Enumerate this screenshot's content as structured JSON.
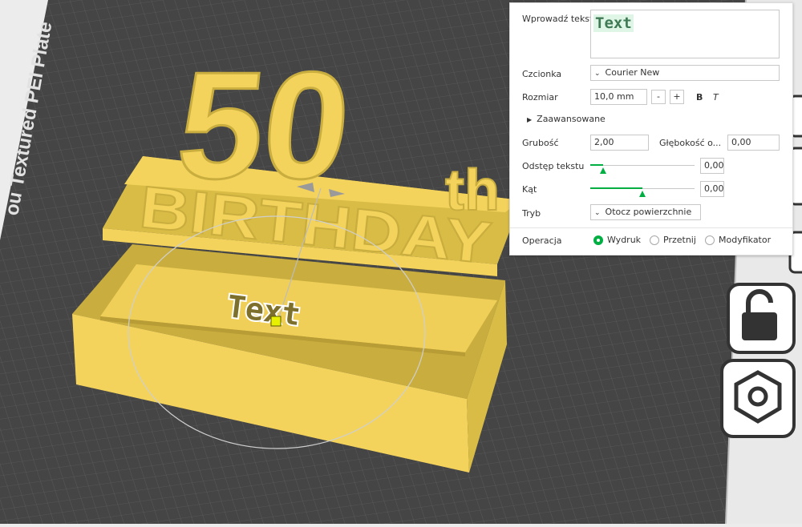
{
  "scene": {
    "plate_label": "ou Textured PEI Plate",
    "model_title_number": "50",
    "model_title_suffix": "th",
    "model_subtitle": "BIRTHDAY",
    "embossed_text": "Text"
  },
  "panel": {
    "text_input_label": "Wprowadź tekst",
    "text_input_value": "Text",
    "font_label": "Czcionka",
    "font_value": "Courier New",
    "size_label": "Rozmiar",
    "size_value": "10,0 mm",
    "size_decrease": "-",
    "size_increase": "+",
    "bold_label": "B",
    "italic_label": "T",
    "advanced_label": "Zaawansowane",
    "thickness_label": "Grubość",
    "thickness_value": "2,00",
    "depth_label": "Głębokość o...",
    "depth_value": "0,00",
    "spacing_label": "Odstęp tekstu",
    "spacing_value": "0,00",
    "spacing_level": 0.12,
    "angle_label": "Kąt",
    "angle_value": "0,00",
    "angle_level": 0.5,
    "mode_label": "Tryb",
    "mode_value": "Otocz powierzchnie",
    "operation_label": "Operacja",
    "operations": [
      {
        "label": "Wydruk",
        "selected": true
      },
      {
        "label": "Przetnij",
        "selected": false
      },
      {
        "label": "Modyfikator",
        "selected": false
      }
    ]
  },
  "colors": {
    "accent": "#00ae42",
    "model": "#f3d35c",
    "plate": "#4a4a4a",
    "panel_bg": "#ffffff"
  },
  "icons": [
    "lock-open-icon",
    "nut-icon"
  ]
}
